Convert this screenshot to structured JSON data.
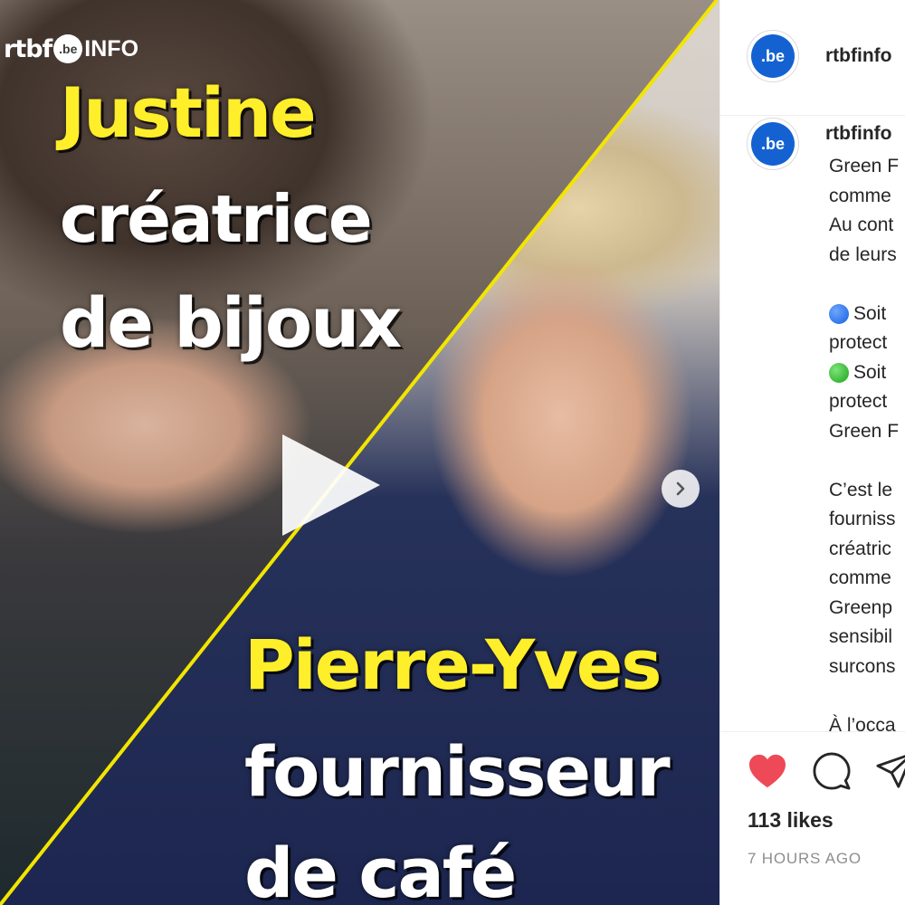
{
  "media": {
    "logo": {
      "rtbf": "rtbf",
      "be": ".be",
      "info": "INFO"
    },
    "captions": {
      "person1_name": "Justine",
      "person1_role_line1": "créatrice",
      "person1_role_line2": "de bijoux",
      "person2_name": "Pierre-Yves",
      "person2_role_line1": "fournisseur",
      "person2_role_line2": "de café"
    },
    "colors": {
      "accent_yellow": "#ffee2a",
      "divider_yellow": "#f2e500"
    }
  },
  "post": {
    "header": {
      "avatar_text": ".be",
      "username": "rtbfinfo"
    },
    "caption": {
      "avatar_text": ".be",
      "username": "rtbfinfo",
      "lines": [
        "Green F",
        "comme",
        "Au cont",
        "de leurs",
        "",
        "Soit",
        "protect",
        "Soit",
        "protect",
        "Green F",
        "",
        "C’est le",
        "fourniss",
        "créatric",
        "comme",
        "Greenp",
        "sensibil",
        "surcons",
        "",
        "À l’occa"
      ]
    },
    "likes": "113 likes",
    "timestamp": "7 HOURS AGO",
    "icons": [
      "heart-icon",
      "comment-icon",
      "share-icon"
    ],
    "colors": {
      "like_red": "#ed4956",
      "avatar_blue": "#1462d2"
    }
  }
}
